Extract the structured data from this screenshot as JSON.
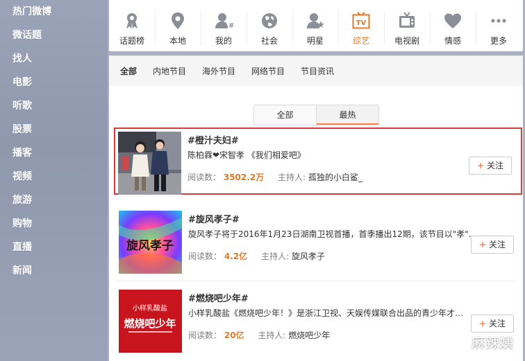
{
  "sidebar": {
    "items": [
      "热门微博",
      "微话题",
      "找人",
      "电影",
      "听歌",
      "股票",
      "播客",
      "视频",
      "旅游",
      "购物",
      "直播",
      "新闻"
    ]
  },
  "categories": [
    {
      "label": "话题榜",
      "icon": "ribbon-medal-icon"
    },
    {
      "label": "本地",
      "icon": "location-pin-icon"
    },
    {
      "label": "我的",
      "icon": "user-hash-icon"
    },
    {
      "label": "社会",
      "icon": "globe-icon"
    },
    {
      "label": "明星",
      "icon": "user-star-icon"
    },
    {
      "label": "综艺",
      "icon": "tv-icon",
      "tv_text": "TV"
    },
    {
      "label": "电视剧",
      "icon": "tv-set-icon"
    },
    {
      "label": "情感",
      "icon": "heart-bubble-icon"
    },
    {
      "label": "更多",
      "icon": "more-dots-icon"
    }
  ],
  "subnav": [
    "全部",
    "内地节目",
    "海外节目",
    "网络节目",
    "节目资讯"
  ],
  "segment": {
    "options": [
      "全部",
      "最热"
    ],
    "active": 1
  },
  "topics": [
    {
      "title": "#橙汁夫妇#",
      "desc": "陈柏霖❤宋智孝 《我们相爱吧》",
      "read_label": "阅读数：",
      "read_count": "3502.2万",
      "host_label": "主持人:",
      "host": "孤独的小白鲨_",
      "follow": "关注"
    },
    {
      "title": "#旋风孝子#",
      "desc": "旋风孝子将于2016年1月23日湖南卫视首播，首季播出12期，该节目以\"孝\"…",
      "read_label": "阅读数：",
      "read_count": "4.2亿",
      "host_label": "主持人:",
      "host": "旋风孝子",
      "follow": "关注"
    },
    {
      "title": "#燃烧吧少年#",
      "desc": "小样乳酸盐《燃烧吧少年！》是浙江卫视、天娱传媒联合出品的青少年才…",
      "read_label": "阅读数：",
      "read_count": "20亿",
      "host_label": "主持人:",
      "host": "燃烧吧少年",
      "follow": "关注"
    }
  ],
  "thumbs": {
    "t2_text": "旋风孝子",
    "t3_top": "小样乳酸盐",
    "t3_main": "燃烧吧少年"
  },
  "watermark": "麻辣姨"
}
